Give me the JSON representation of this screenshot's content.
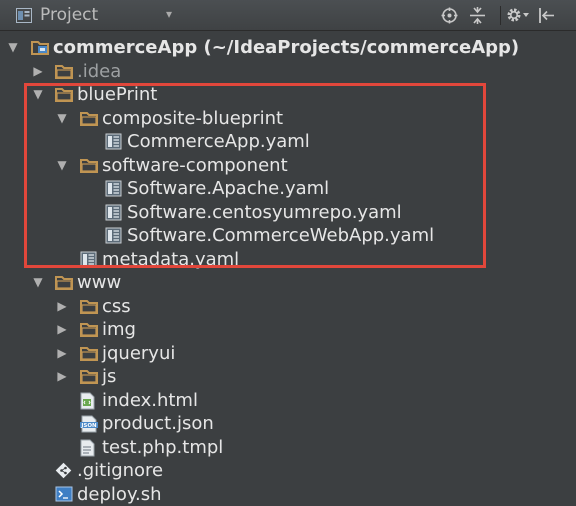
{
  "header": {
    "title": "Project",
    "caret": "▾"
  },
  "tree": [
    {
      "depth": 0,
      "arrow": "▼",
      "icon": "module-folder-icon",
      "label": "commerceApp",
      "suffix": " (~/IdeaProjects/commerceApp)",
      "style": "bold"
    },
    {
      "depth": 1,
      "arrow": "▶",
      "icon": "folder-icon",
      "label": ".idea",
      "style": "dim"
    },
    {
      "depth": 1,
      "arrow": "▼",
      "icon": "folder-icon",
      "label": "bluePrint"
    },
    {
      "depth": 2,
      "arrow": "▼",
      "icon": "folder-icon",
      "label": "composite-blueprint"
    },
    {
      "depth": 3,
      "arrow": "",
      "icon": "yaml-file-icon",
      "label": "CommerceApp.yaml"
    },
    {
      "depth": 2,
      "arrow": "▼",
      "icon": "folder-icon",
      "label": "software-component"
    },
    {
      "depth": 3,
      "arrow": "",
      "icon": "yaml-file-icon",
      "label": "Software.Apache.yaml"
    },
    {
      "depth": 3,
      "arrow": "",
      "icon": "yaml-file-icon",
      "label": "Software.centosyumrepo.yaml"
    },
    {
      "depth": 3,
      "arrow": "",
      "icon": "yaml-file-icon",
      "label": "Software.CommerceWebApp.yaml"
    },
    {
      "depth": 2,
      "arrow": "",
      "icon": "yaml-file-icon",
      "label": "metadata.yaml"
    },
    {
      "depth": 1,
      "arrow": "▼",
      "icon": "folder-icon",
      "label": "www"
    },
    {
      "depth": 2,
      "arrow": "▶",
      "icon": "folder-icon",
      "label": "css"
    },
    {
      "depth": 2,
      "arrow": "▶",
      "icon": "folder-icon",
      "label": "img"
    },
    {
      "depth": 2,
      "arrow": "▶",
      "icon": "folder-icon",
      "label": "jqueryui"
    },
    {
      "depth": 2,
      "arrow": "▶",
      "icon": "folder-icon",
      "label": "js"
    },
    {
      "depth": 2,
      "arrow": "",
      "icon": "html-file-icon",
      "label": "index.html"
    },
    {
      "depth": 2,
      "arrow": "",
      "icon": "json-file-icon",
      "label": "product.json"
    },
    {
      "depth": 2,
      "arrow": "",
      "icon": "text-file-icon",
      "label": "test.php.tmpl"
    },
    {
      "depth": 1,
      "arrow": "",
      "icon": "gitignore-file-icon",
      "label": ".gitignore"
    },
    {
      "depth": 1,
      "arrow": "",
      "icon": "shell-file-icon",
      "label": "deploy.sh"
    }
  ],
  "colors": {
    "background": "#3c3f41",
    "text": "#e6e6e6",
    "dim_text": "#9da0a2",
    "folder": "#c09553",
    "highlight": "#e2473b"
  }
}
